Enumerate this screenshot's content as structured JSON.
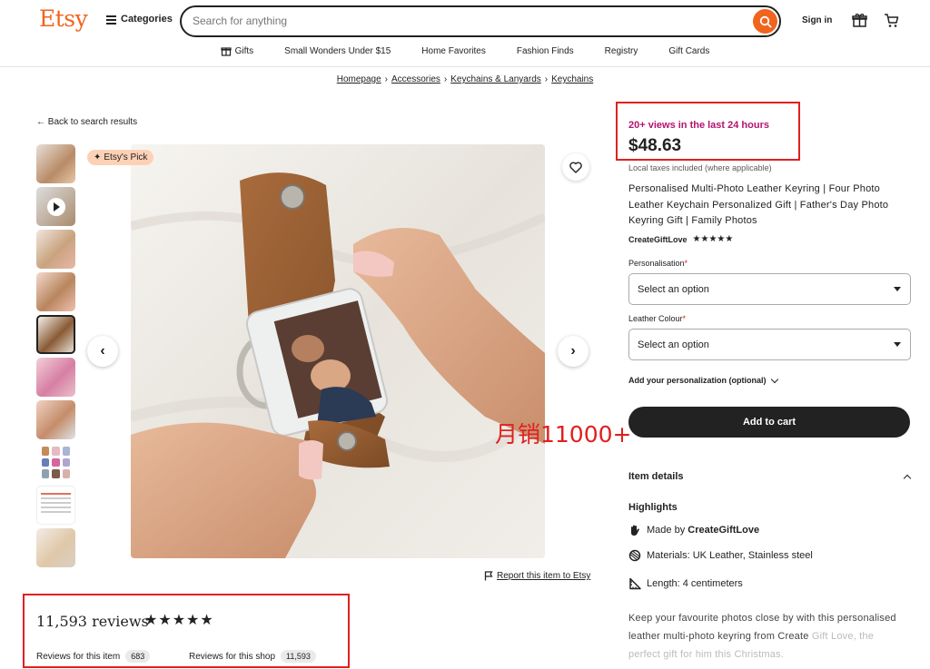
{
  "header": {
    "logo": "Etsy",
    "categories": "Categories",
    "search_placeholder": "Search for anything",
    "sign_in": "Sign in"
  },
  "nav": [
    {
      "label": "Gifts"
    },
    {
      "label": "Small Wonders Under $15"
    },
    {
      "label": "Home Favorites"
    },
    {
      "label": "Fashion Finds"
    },
    {
      "label": "Registry"
    },
    {
      "label": "Gift Cards"
    }
  ],
  "breadcrumb": [
    "Homepage",
    "Accessories",
    "Keychains & Lanyards",
    "Keychains"
  ],
  "back_link": "Back to search results",
  "badge": "Etsy's Pick",
  "report_link": "Report this item to Etsy",
  "reviews": {
    "count_text": "11,593 reviews",
    "stars": "★★★★★",
    "tab_item": "Reviews for this item",
    "tab_item_count": "683",
    "tab_shop": "Reviews for this shop",
    "tab_shop_count": "11,593"
  },
  "product": {
    "views": "20+ views in the last 24 hours",
    "price": "$48.63",
    "tax_note": "Local taxes included (where applicable)",
    "title": "Personalised Multi-Photo Leather Keyring | Four Photo Leather Keychain Personalized Gift | Father's Day Photo Keyring Gift | Family Photos",
    "shop_name": "CreateGiftLove",
    "shop_stars": "★★★★★",
    "personalisation_label": "Personalisation",
    "personalisation_value": "Select an option",
    "colour_label": "Leather Colour",
    "colour_value": "Select an option",
    "add_personalization": "Add your personalization (optional)",
    "add_to_cart": "Add to cart",
    "item_details": "Item details",
    "highlights_title": "Highlights",
    "made_by_prefix": "Made by ",
    "made_by_shop": "CreateGiftLove",
    "materials": "Materials: UK Leather, Stainless steel",
    "length": "Length: 4 centimeters",
    "description": "Keep your favourite photos close by with this personalised leather multi-photo keyring from Create",
    "description_faded": "Gift Love, the perfect gift for him this Christmas."
  },
  "annotation": "月销11000+",
  "colors": {
    "brand": "#f1641e",
    "highlight_red": "#e02020",
    "views_magenta": "#b3146f"
  }
}
